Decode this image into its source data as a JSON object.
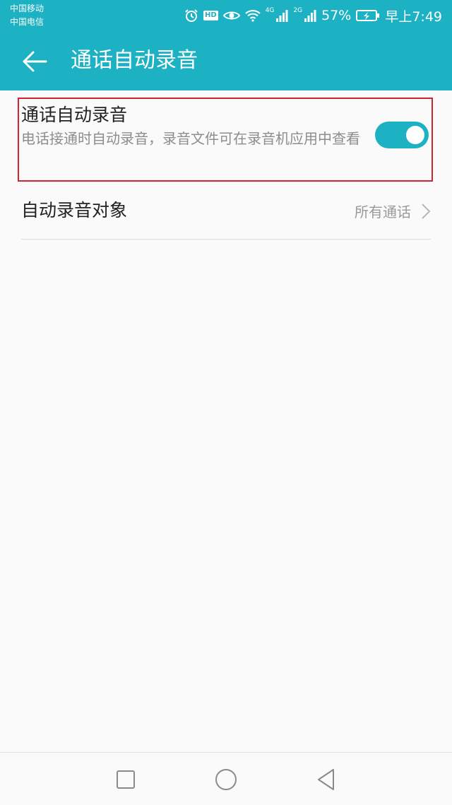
{
  "status_bar": {
    "carrier1": "中国移动",
    "carrier2": "中国电信",
    "hd_label": "HD",
    "net1": "4G",
    "net2": "2G",
    "battery": "57%",
    "time": "早上7:49",
    "icons": [
      "alarm-icon",
      "hd-icon",
      "eye-comfort-icon",
      "wifi-icon",
      "signal-icon",
      "signal-icon",
      "battery-charging-icon"
    ]
  },
  "app_bar": {
    "title": "通话自动录音",
    "back_icon": "arrow-left-icon"
  },
  "settings": {
    "auto_record": {
      "title": "通话自动录音",
      "description": "电话接通时自动录音，录音文件可在录音机应用中查看",
      "enabled": true
    },
    "record_target": {
      "label": "自动录音对象",
      "value": "所有通话"
    }
  },
  "nav_bar": {
    "buttons": [
      "recents-square-icon",
      "home-circle-icon",
      "back-triangle-icon"
    ]
  },
  "colors": {
    "accent": "#1cb1c3",
    "highlight_border": "#d0252b",
    "background": "#fafafa"
  }
}
